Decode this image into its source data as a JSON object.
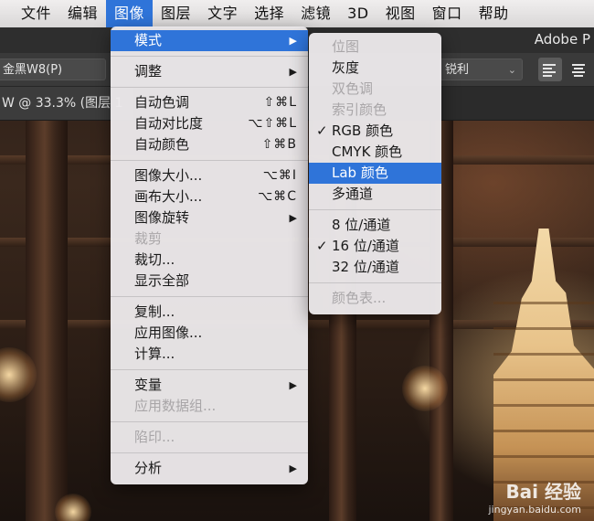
{
  "menubar": {
    "items": [
      "文件",
      "编辑",
      "图像",
      "图层",
      "文字",
      "选择",
      "滤镜",
      "3D",
      "视图",
      "窗口",
      "帮助"
    ],
    "active_index": 2
  },
  "app": {
    "title": "Adobe P"
  },
  "options": {
    "font_family": "金黑W8(P)",
    "anti_alias": "锐利"
  },
  "document": {
    "tab": "W @ 33.3% (图层 1"
  },
  "image_menu": {
    "mode": "模式",
    "adjust": "调整",
    "auto_tone": "自动色调",
    "auto_tone_sc": "⇧⌘L",
    "auto_contrast": "自动对比度",
    "auto_contrast_sc": "⌥⇧⌘L",
    "auto_color": "自动颜色",
    "auto_color_sc": "⇧⌘B",
    "image_size": "图像大小...",
    "image_size_sc": "⌥⌘I",
    "canvas_size": "画布大小...",
    "canvas_size_sc": "⌥⌘C",
    "rotation": "图像旋转",
    "crop": "裁剪",
    "trim": "裁切...",
    "reveal_all": "显示全部",
    "duplicate": "复制...",
    "apply_image": "应用图像...",
    "calculations": "计算...",
    "variables": "变量",
    "apply_data_set": "应用数据组...",
    "trap": "陷印...",
    "analysis": "分析"
  },
  "mode_menu": {
    "bitmap": "位图",
    "grayscale": "灰度",
    "duotone": "双色调",
    "indexed": "索引颜色",
    "rgb": "RGB 颜色",
    "cmyk": "CMYK 颜色",
    "lab": "Lab 颜色",
    "multichannel": "多通道",
    "bits8": "8 位/通道",
    "bits16": "16 位/通道",
    "bits32": "32 位/通道",
    "color_table": "颜色表...",
    "check": "✓"
  },
  "watermark": {
    "brand": "Bai 经验",
    "url": "jingyan.baidu.com"
  },
  "colors": {
    "highlight": "#2f74d9"
  }
}
